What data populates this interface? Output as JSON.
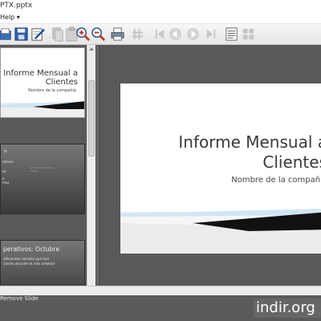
{
  "window": {
    "title": "PTX.pptx"
  },
  "menu": {
    "help_label": "Help ▾"
  },
  "toolbar": {
    "buttons": [
      "open-file",
      "save",
      "edit",
      "copy",
      "paste",
      "zoom-in",
      "zoom-out",
      "print",
      "fit",
      "first-slide",
      "previous-slide",
      "next-slide",
      "last-slide",
      "slide-view",
      "grid-view"
    ]
  },
  "thumbnails": {
    "slide1": {
      "title": "Informe Mensual a Clientes",
      "subtitle": "Nombre de la compañía"
    },
    "slide2": {
      "heading": "o",
      "bullet1": "rativos",
      "bullet2": "es",
      "bullet3": "e\nmas",
      "right_text": "xxx xxxxx xx xxxxx\nxxxxxx"
    },
    "slide3": {
      "heading": "perativos: Octubre",
      "body": "diferentes clientes que han\nciones durante el mes anterior"
    }
  },
  "slide": {
    "title_line1": "Informe Mensual a",
    "title_line2": "Clientes",
    "subtitle": "Nombre de la compañía"
  },
  "status": {
    "text": "Remove Slide"
  },
  "watermark": {
    "text": "indir.org"
  },
  "colors": {
    "pane_bg": "#595959",
    "slide_bg": "#ffffff",
    "accent_light": "#cfe6f5"
  }
}
